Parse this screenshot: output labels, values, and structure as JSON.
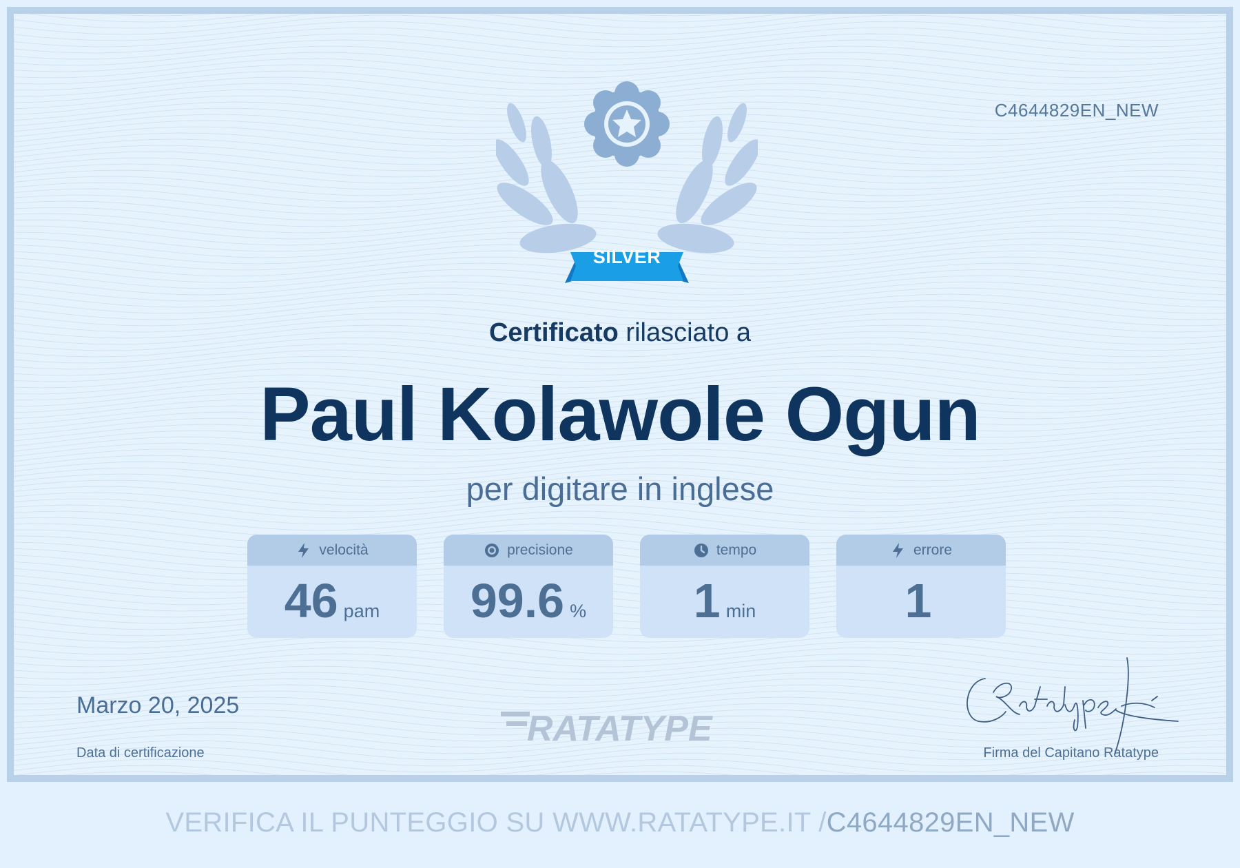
{
  "certificate": {
    "id": "C4644829EN_NEW",
    "badge": "SILVER",
    "heading_bold": "Certificato",
    "heading_rest": " rilasciato a",
    "recipient": "Paul Kolawole Ogun",
    "subject": "per digitare in inglese",
    "stats": [
      {
        "label": "velocità",
        "value": "46",
        "unit": "pam",
        "icon": "lightning-icon"
      },
      {
        "label": "precisione",
        "value": "99.6",
        "unit": "%",
        "icon": "target-icon"
      },
      {
        "label": "tempo",
        "value": "1",
        "unit": "min",
        "icon": "clock-icon"
      },
      {
        "label": "errore",
        "value": "1",
        "unit": "",
        "icon": "lightning-icon"
      }
    ],
    "date": "Marzo 20, 2025",
    "date_label": "Data di certificazione",
    "brand": "RATATYPE",
    "signature_label": "Firma del Capitano Ratatype"
  },
  "footer": {
    "verify_text": "VERIFICA IL PUNTEGGIO SU WWW.RATATYPE.IT /",
    "verify_code": "C4644829EN_NEW"
  },
  "colors": {
    "primary_text": "#0f355e",
    "accent_ribbon": "#1a9fe6",
    "emblem": "#8daed3",
    "frame": "#b9d0e9"
  }
}
